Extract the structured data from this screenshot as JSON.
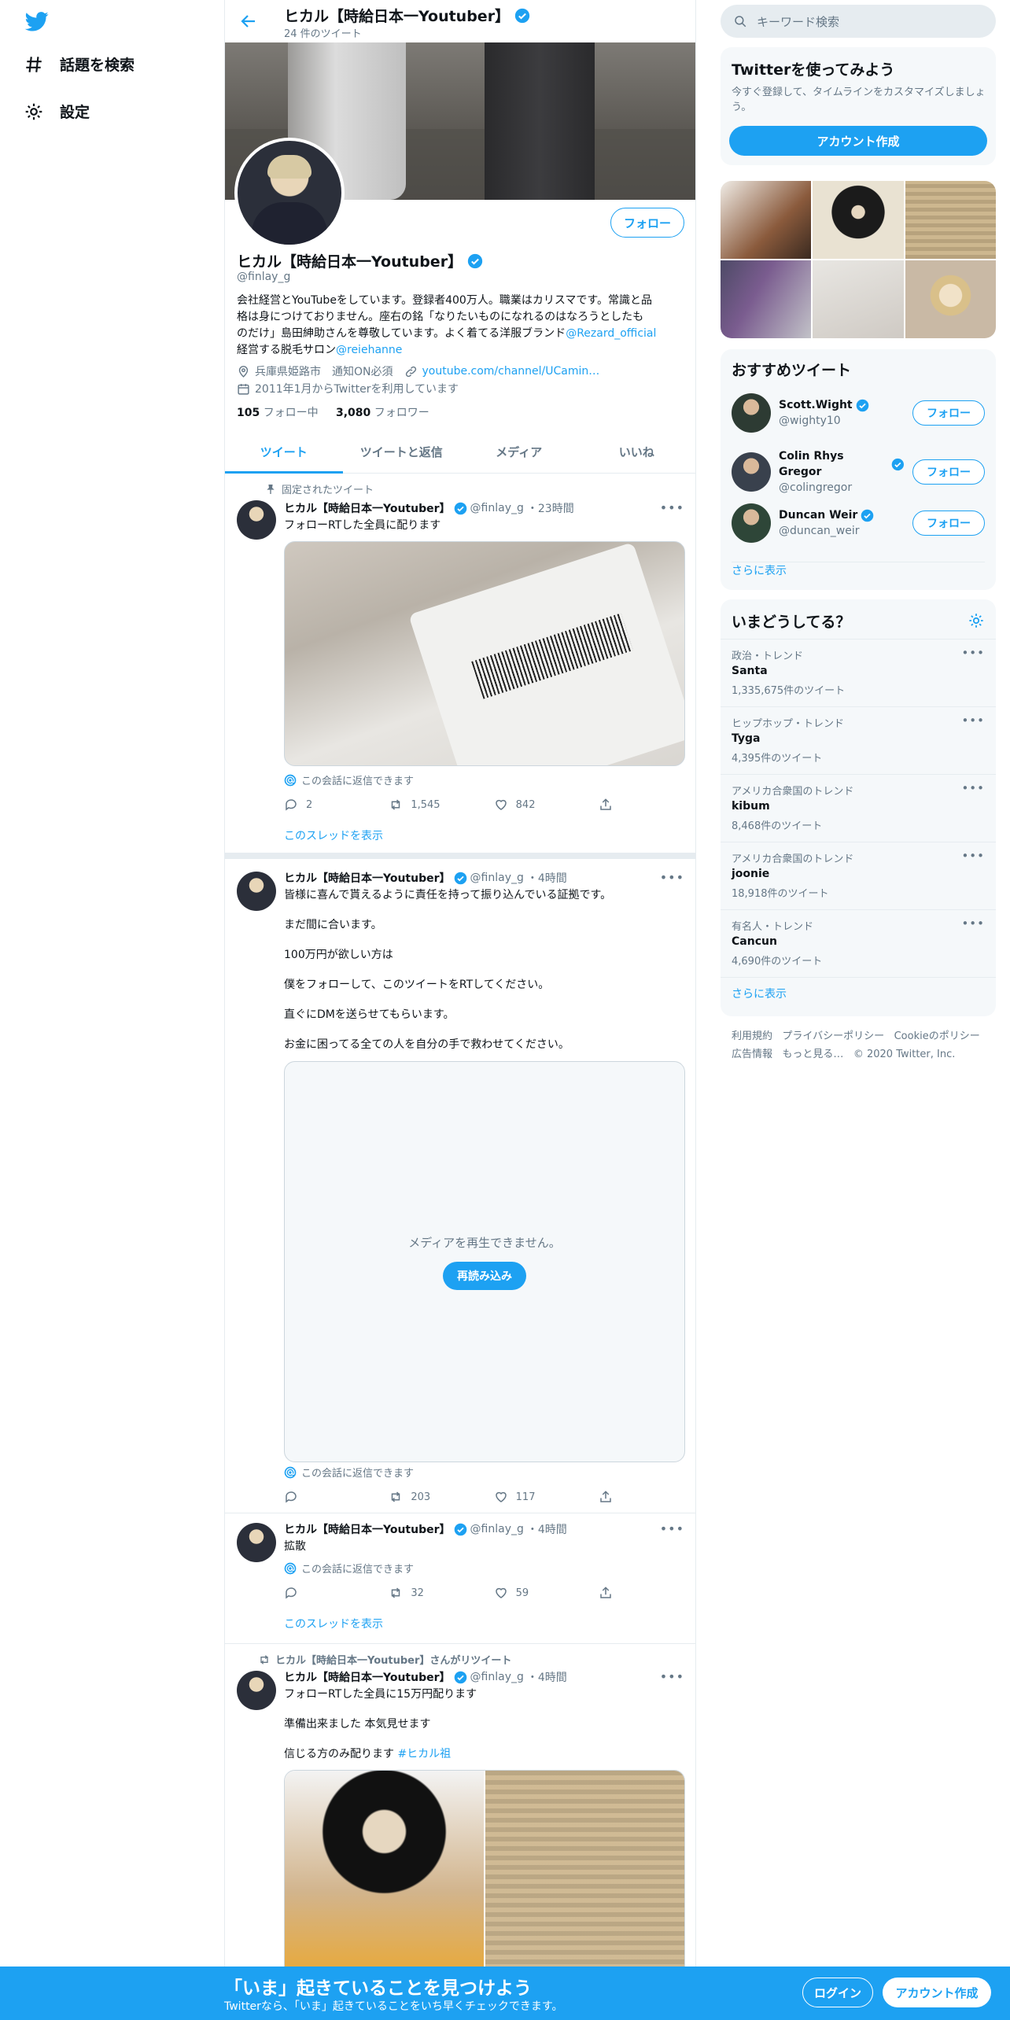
{
  "nav": {
    "explore": "話題を検索",
    "settings": "設定"
  },
  "header": {
    "name": "ヒカル【時給日本一Youtuber】",
    "tweet_count": "24 件のツイート"
  },
  "profile": {
    "name": "ヒカル【時給日本一Youtuber】",
    "handle": "@finlay_g",
    "follow": "フォロー",
    "bio_line1": "会社経営とYouTubeをしています。登録者400万人。職業はカリスマです。常識と品",
    "bio_line2": "格は身につけておりません。座右の銘「なりたいものになれるのはなろうとしたも",
    "bio_line3": "のだけ」島田紳助さんを尊敬しています。よく着てる洋服ブランド",
    "bio_link1": "@Rezard_official",
    "bio_line4": "経営する脱毛サロン",
    "bio_link2": "@reiehanne",
    "location": "兵庫県姫路市　通知ON必須",
    "url": "youtube.com/channel/UCamin…",
    "joined": "2011年1月からTwitterを利用しています",
    "following_count": "105",
    "following_label": "フォロー中",
    "followers_count": "3,080",
    "followers_label": "フォロワー"
  },
  "tabs": [
    "ツイート",
    "ツイートと返信",
    "メディア",
    "いいね"
  ],
  "tweets": [
    {
      "pinned": "固定されたツイート",
      "name": "ヒカル【時給日本一Youtuber】",
      "handle": "@finlay_g",
      "time": "・23時間",
      "text": "フォローRTした全員に配ります",
      "reply_notice": "この会話に返信できます",
      "replies": "2",
      "retweets": "1,545",
      "likes": "842",
      "thread": "このスレッドを表示"
    },
    {
      "name": "ヒカル【時給日本一Youtuber】",
      "handle": "@finlay_g",
      "time": "・4時間",
      "line1": "皆様に喜んで貰えるように責任を持って振り込んでいる証拠です。",
      "line2": "まだ間に合います。",
      "line3": "100万円が欲しい方は",
      "line4": "僕をフォローして、このツイートをRTしてください。",
      "line5": "直ぐにDMを送らせてもらいます。",
      "line6": "お金に困ってる全ての人を自分の手で救わせてください。",
      "media_error": "メディアを再生できません。",
      "reload": "再読み込み",
      "reply_notice": "この会話に返信できます",
      "replies": "",
      "retweets": "203",
      "likes": "117"
    },
    {
      "name": "ヒカル【時給日本一Youtuber】",
      "handle": "@finlay_g",
      "time": "・4時間",
      "text": "拡散",
      "reply_notice": "この会話に返信できます",
      "replies": "",
      "retweets": "32",
      "likes": "59",
      "thread": "このスレッドを表示"
    },
    {
      "retweeted_by": "ヒカル【時給日本一Youtuber】さんがリツイート",
      "name": "ヒカル【時給日本一Youtuber】",
      "handle": "@finlay_g",
      "time": "・4時間",
      "line1": "フォローRTした全員に15万円配ります",
      "line2": "準備出来ました 本気見せます",
      "line3": "信じる方のみ配ります",
      "hashtag": "#ヒカル祖"
    }
  ],
  "search": {
    "placeholder": "キーワード検索"
  },
  "signup_box": {
    "title": "Twitterを使ってみよう",
    "line1": "今すぐ登録して、タイムラインをカスタマイズしましょ",
    "line2": "う。",
    "button": "アカウント作成"
  },
  "suggestions": {
    "title": "おすすめツイート",
    "follow": "フォロー",
    "more": "さらに表示",
    "users": [
      {
        "name": "Scott.Wight",
        "handle": "@wighty10"
      },
      {
        "name": "Colin Rhys Gregor",
        "handle": "@colingregor"
      },
      {
        "name": "Duncan Weir",
        "handle": "@duncan_weir"
      }
    ]
  },
  "trends": {
    "title": "いまどうしてる？",
    "more": "さらに表示",
    "items": [
      {
        "context": "政治・トレンド",
        "name": "Santa",
        "count": "1,335,675件のツイート"
      },
      {
        "context": "ヒップホップ・トレンド",
        "name": "Tyga",
        "count": "4,395件のツイート"
      },
      {
        "context": "アメリカ合衆国のトレンド",
        "name": "kibum",
        "count": "8,468件のツイート"
      },
      {
        "context": "アメリカ合衆国のトレンド",
        "name": "joonie",
        "count": "18,918件のツイート"
      },
      {
        "context": "有名人・トレンド",
        "name": "Cancun",
        "count": "4,690件のツイート"
      }
    ]
  },
  "footer": {
    "terms": "利用規約",
    "privacy": "プライバシーポリシー",
    "cookie": "Cookieのポリシー",
    "ads": "広告情報",
    "more": "もっと見る…",
    "copyright": "© 2020 Twitter, Inc."
  },
  "bottom": {
    "title": "「いま」起きていることを見つけよう",
    "subtitle": "Twitterなら、「いま」起きていることをいち早くチェックできます。",
    "login": "ログイン",
    "signup": "アカウント作成"
  },
  "colors": {
    "accent": "#1da1f2",
    "text": "#0f1419",
    "muted": "#657786",
    "border": "#e6ecf0"
  }
}
